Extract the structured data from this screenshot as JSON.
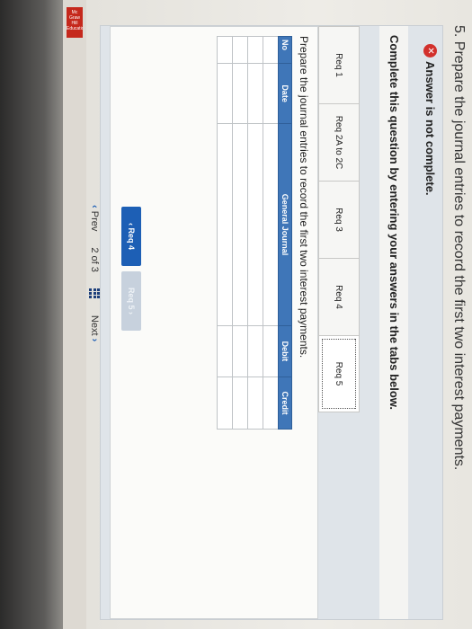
{
  "question": {
    "title": "5. Prepare the journal entries to record the first two interest payments."
  },
  "brand": {
    "logo_text": "Mc Graw Hill Education",
    "logo_color": "#c5281c"
  },
  "answer": {
    "status_icon": "x-circle-icon",
    "status_text": "Answer is not complete.",
    "instruction": "Complete this question by entering your answers in the tabs below."
  },
  "tabs": [
    {
      "label": "Req 1"
    },
    {
      "label": "Req 2A to 2C"
    },
    {
      "label": "Req 3"
    },
    {
      "label": "Req 4"
    },
    {
      "label": "Req 5",
      "active": true
    }
  ],
  "panel": {
    "prompt": "Prepare the journal entries to record the first two interest payments.",
    "table": {
      "headers": [
        "No",
        "Date",
        "General Journal",
        "Debit",
        "Credit"
      ],
      "rows": 4
    },
    "prev_button": "‹  Req 4",
    "next_button": "Req 5  ›"
  },
  "pager": {
    "prev": "Prev",
    "page": "2 of 3",
    "next": "Next"
  },
  "colors": {
    "accent": "#1d5fb5",
    "table_header": "#3f76b8",
    "error": "#d2302c"
  }
}
